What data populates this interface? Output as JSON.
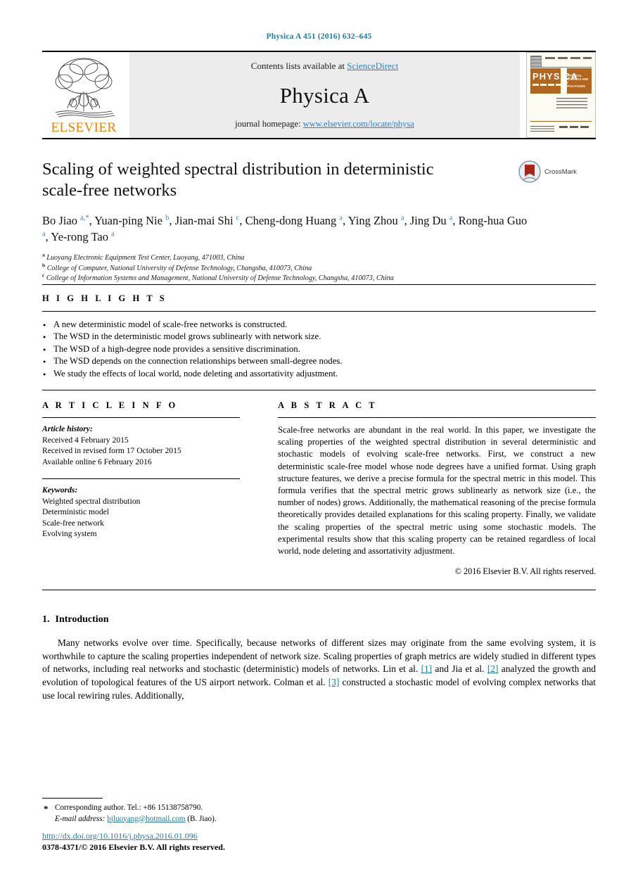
{
  "running_head": "Physica A 451 (2016) 632–645",
  "masthead": {
    "publisher_word": "ELSEVIER",
    "contents_prefix": "Contents lists available at ",
    "contents_link": "ScienceDirect",
    "journal_name": "Physica A",
    "homepage_prefix": "journal homepage: ",
    "homepage_url": "www.elsevier.com/locate/physa",
    "cover": {
      "title": "PHYSICA",
      "subtitle": "STATISTICAL MECHANICS AND ITS APPLICATIONS"
    }
  },
  "article": {
    "title": "Scaling of weighted spectral distribution in deterministic scale-free networks",
    "crossmark_label": "CrossMark",
    "authors_html": "Bo Jiao <sup class=\"aff-mark\">a,*</sup>, Yuan-ping Nie <sup class=\"aff-mark\">b</sup>, Jian-mai Shi <sup class=\"aff-mark\">c</sup>, Cheng-dong Huang <sup class=\"aff-mark\">a</sup>, Ying Zhou <sup class=\"aff-mark\">a</sup>, Jing Du <sup class=\"aff-mark\">a</sup>, Rong-hua Guo <sup class=\"aff-mark\">a</sup>, Ye-rong Tao <sup class=\"aff-mark\">a</sup>",
    "affiliations": [
      {
        "mark": "a",
        "text": "Luoyang Electronic Equipment Test Center, Luoyang, 471003, China"
      },
      {
        "mark": "b",
        "text": "College of Computer, National University of Defense Technology, Changsha, 410073, China"
      },
      {
        "mark": "c",
        "text": "College of Information Systems and Management, National University of Defense Technology, Changsha, 410073, China"
      }
    ]
  },
  "highlights": {
    "heading": "H I G H L I G H T S",
    "items": [
      "A new deterministic model of scale-free networks is constructed.",
      "The WSD in the deterministic model grows sublinearly with network size.",
      "The WSD of a high-degree node provides a sensitive discrimination.",
      "The WSD depends on the connection relationships between small-degree nodes.",
      "We study the effects of local world, node deleting and assortativity adjustment."
    ]
  },
  "article_info": {
    "heading": "A R T I C L E    I N F O",
    "history_label": "Article history:",
    "history": [
      "Received 4 February 2015",
      "Received in revised form 17 October 2015",
      "Available online 6 February 2016"
    ],
    "keywords_label": "Keywords:",
    "keywords": [
      "Weighted spectral distribution",
      "Deterministic model",
      "Scale-free network",
      "Evolving system"
    ]
  },
  "abstract": {
    "heading": "A B S T R A C T",
    "text": "Scale-free networks are abundant in the real world. In this paper, we investigate the scaling properties of the weighted spectral distribution in several deterministic and stochastic models of evolving scale-free networks. First, we construct a new deterministic scale-free model whose node degrees have a unified format. Using graph structure features, we derive a precise formula for the spectral metric in this model. This formula verifies that the spectral metric grows sublinearly as network size (i.e., the number of nodes) grows. Additionally, the mathematical reasoning of the precise formula theoretically provides detailed explanations for this scaling property. Finally, we validate the scaling properties of the spectral metric using some stochastic models. The experimental results show that this scaling property can be retained regardless of local world, node deleting and assortativity adjustment.",
    "copyright": "© 2016 Elsevier B.V. All rights reserved."
  },
  "introduction": {
    "number": "1.",
    "heading": "Introduction",
    "paragraph_parts": {
      "p1": "Many networks evolve over time. Specifically, because networks of different sizes may originate from the same evolving system, it is worthwhile to capture the scaling properties independent of network size. Scaling properties of graph metrics are widely studied in different types of networks, including real networks and stochastic (deterministic) models of networks. Lin et al. ",
      "cite1": "[1]",
      "p2": " and Jia et al. ",
      "cite2": "[2]",
      "p3": " analyzed the growth and evolution of topological features of the US airport network. Colman et al. ",
      "cite3": "[3]",
      "p4": " constructed a stochastic model of evolving complex networks that use local rewiring rules. Additionally,"
    }
  },
  "footer": {
    "corresponding_label": "Corresponding author. Tel.: +86 15138758790.",
    "email_label": "E-mail address:",
    "email": "bjluoyang@hotmail.com",
    "email_owner": "(B. Jiao).",
    "doi": "http://dx.doi.org/10.1016/j.physa.2016.01.096",
    "issn": "0378-4371/© 2016 Elsevier B.V. All rights reserved."
  },
  "colors": {
    "link": "#2b7fc4",
    "runhead": "#1f7ba3",
    "elsevier_orange": "#F08000",
    "crossmark_red": "#b5281e",
    "cover_brown": "#b1651f"
  }
}
